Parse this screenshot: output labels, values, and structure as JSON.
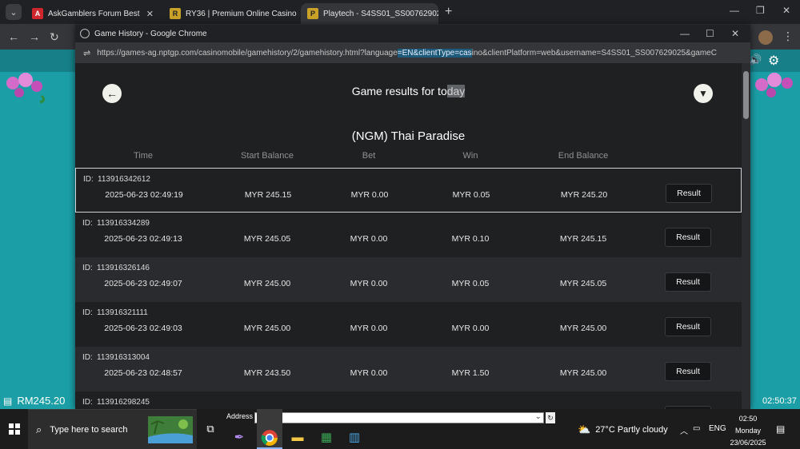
{
  "browser": {
    "tabs": [
      {
        "label": "AskGamblers Forum Best",
        "icon": "askgamblers-favicon"
      },
      {
        "label": "RY36 | Premium Online Casino",
        "icon": "ry36-favicon"
      },
      {
        "label": "Playtech - S4SS01_SS00762902",
        "icon": "playtech-favicon"
      }
    ],
    "tab_close": "✕",
    "new_tab": "+"
  },
  "popup": {
    "title": "Game History - Google Chrome",
    "url_before": "https://games-ag.nptgp.com/casinomobile/gamehistory/2/gamehistory.html?language",
    "url_highlight": "=EN&clientType=cas",
    "url_after": "ino&clientPlatform=web&username=S4SS01_SS007629025&gameC"
  },
  "page": {
    "heading_prefix": "Game results for to",
    "heading_selected": "day",
    "game_name": "(NGM) Thai Paradise",
    "columns": [
      "Time",
      "Start Balance",
      "Bet",
      "Win",
      "End Balance"
    ],
    "id_label": "ID:",
    "result_label": "Result",
    "rows": [
      {
        "id": "113916342612",
        "time": "2025-06-23  02:49:19",
        "start": "MYR 245.15",
        "bet": "MYR 0.00",
        "win": "MYR 0.05",
        "end": "MYR 245.20"
      },
      {
        "id": "113916334289",
        "time": "2025-06-23  02:49:13",
        "start": "MYR 245.05",
        "bet": "MYR 0.00",
        "win": "MYR 0.10",
        "end": "MYR 245.15"
      },
      {
        "id": "113916326146",
        "time": "2025-06-23  02:49:07",
        "start": "MYR 245.00",
        "bet": "MYR 0.00",
        "win": "MYR 0.05",
        "end": "MYR 245.05"
      },
      {
        "id": "113916321111",
        "time": "2025-06-23  02:49:03",
        "start": "MYR 245.00",
        "bet": "MYR 0.00",
        "win": "MYR 0.00",
        "end": "MYR 245.00"
      },
      {
        "id": "113916313004",
        "time": "2025-06-23  02:48:57",
        "start": "MYR 243.50",
        "bet": "MYR 0.00",
        "win": "MYR 1.50",
        "end": "MYR 245.00"
      },
      {
        "id": "113916298245",
        "time": "",
        "start": "",
        "bet": "",
        "win": "",
        "end": ""
      }
    ]
  },
  "game": {
    "balance": "RM245.20",
    "clock": "02:50:37"
  },
  "taskbar": {
    "search_placeholder": "Type here to search",
    "address_label": "Address",
    "weather": "27°C  Partly cloudy",
    "language": "ENG",
    "time": "02:50",
    "day": "Monday",
    "date": "23/06/2025"
  },
  "colors": {
    "game_teal": "#1b9ea6",
    "page_bg": "#1f2022",
    "row_alt": "#2a2b2e",
    "url_highlight": "#1e5a7a"
  }
}
